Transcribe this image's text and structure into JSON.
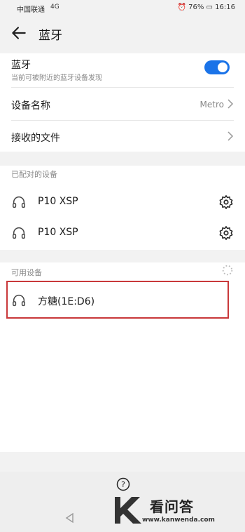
{
  "status_bar": {
    "carrier": "中国联通",
    "signal": "4G",
    "battery": "76%",
    "time": "16:16"
  },
  "header": {
    "title": "蓝牙"
  },
  "settings": {
    "bluetooth_label": "蓝牙",
    "bluetooth_sub": "当前可被附近的蓝牙设备发现",
    "bluetooth_on": true,
    "device_name_label": "设备名称",
    "device_name_value": "Metro",
    "received_files_label": "接收的文件"
  },
  "paired": {
    "header": "已配对的设备",
    "devices": [
      {
        "name": "P10  XSP"
      },
      {
        "name": "P10  XSP"
      }
    ]
  },
  "available": {
    "header": "可用设备",
    "devices": [
      {
        "name": "方糖(1E:D6)"
      }
    ]
  },
  "watermark": {
    "title": "看问答",
    "url": "www.kanwenda.com"
  },
  "colors": {
    "accent": "#1a73e8",
    "highlight": "#c9383a"
  }
}
